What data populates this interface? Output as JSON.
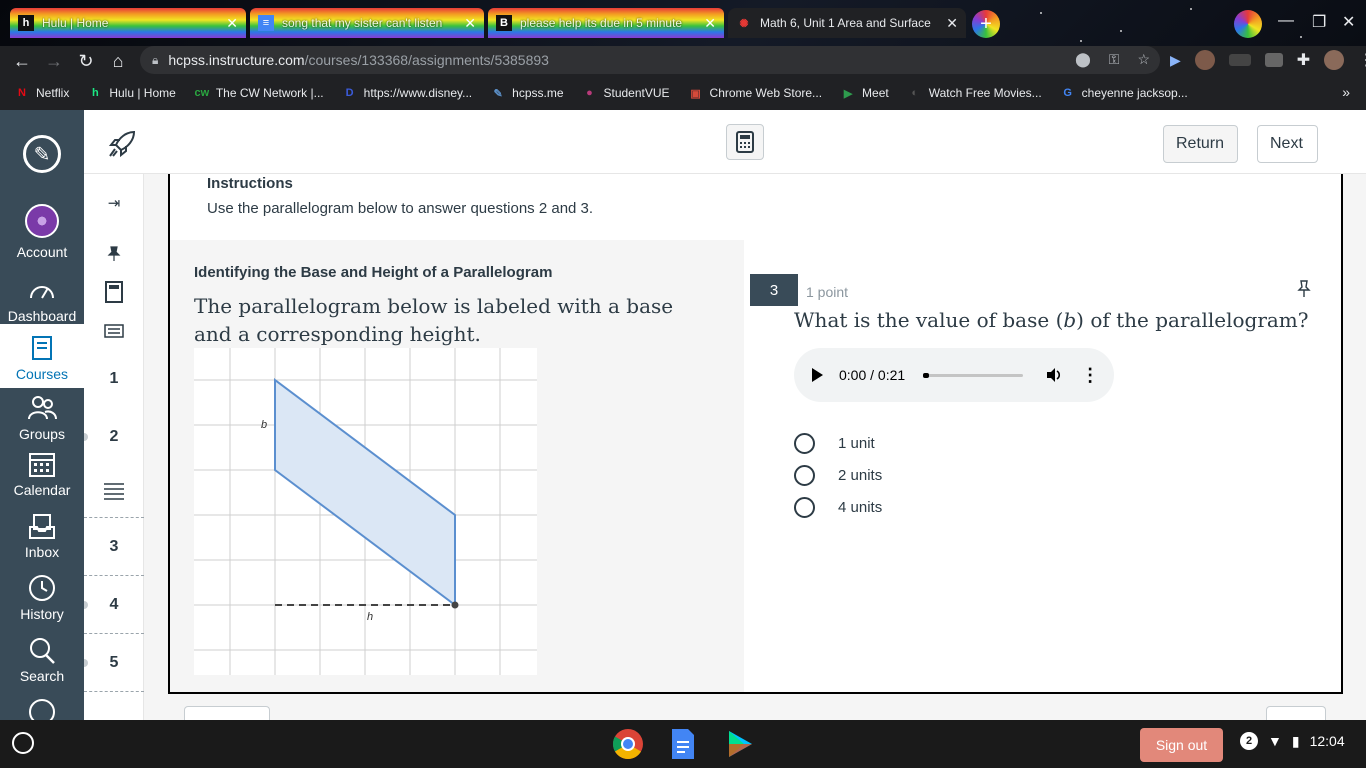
{
  "browser": {
    "tabs": [
      {
        "favicon": "h",
        "title": "Hulu | Home"
      },
      {
        "favicon": "≡",
        "title": "song that my sister can't listen"
      },
      {
        "favicon": "B",
        "title": "please help its due in 5 minute"
      },
      {
        "favicon": "✺",
        "title": "Math 6, Unit 1 Area and Surface"
      }
    ],
    "url_host": "hcpss.instructure.com",
    "url_path": "/courses/133368/assignments/5385893",
    "bookmarks": [
      {
        "icon": "N",
        "label": "Netflix",
        "color": "#e50914"
      },
      {
        "icon": "h",
        "label": "Hulu | Home",
        "color": "#1ce783"
      },
      {
        "icon": "cw",
        "label": "The CW Network |...",
        "color": "#2aa640"
      },
      {
        "icon": "D",
        "label": "https://www.disney...",
        "color": "#3b5bdb"
      },
      {
        "icon": "✎",
        "label": "hcpss.me",
        "color": "#5b8fc7"
      },
      {
        "icon": "●",
        "label": "StudentVUE",
        "color": "#b83a7a"
      },
      {
        "icon": "▣",
        "label": "Chrome Web Store...",
        "color": "#d44a3a"
      },
      {
        "icon": "▶",
        "label": "Meet",
        "color": "#2e9b4d"
      },
      {
        "icon": "◐",
        "label": "Watch Free Movies...",
        "color": "#555555"
      },
      {
        "icon": "G",
        "label": "cheyenne jacksop...",
        "color": "#4285f4"
      }
    ]
  },
  "globalnav": {
    "items": [
      {
        "label": "Account"
      },
      {
        "label": "Dashboard"
      },
      {
        "label": "Courses"
      },
      {
        "label": "Groups"
      },
      {
        "label": "Calendar"
      },
      {
        "label": "Inbox"
      },
      {
        "label": "History"
      },
      {
        "label": "Search"
      }
    ]
  },
  "header": {
    "return_label": "Return",
    "next_label": "Next"
  },
  "qnav": {
    "numbers": [
      "1",
      "2",
      "3",
      "4",
      "5"
    ]
  },
  "instructions": {
    "title": "Instructions",
    "text": "Use the parallelogram below to answer questions 2 and 3."
  },
  "stimulus": {
    "title": "Identifying the Base and Height of a Parallelogram",
    "body": " The parallelogram below is labeled with a base and a corresponding height.",
    "label_b": "b",
    "label_h": "h"
  },
  "question": {
    "number": "3",
    "points": "1 point",
    "text": "What is the value of base (𝑏) of the parallelogram?",
    "audio_time": "0:00 / 0:21",
    "audio_progress": 0.03,
    "options": [
      "1 unit",
      "2 units",
      "4 units"
    ]
  },
  "shelf": {
    "signout_label": "Sign out",
    "notifications": "2",
    "time": "12:04"
  },
  "colors": {
    "nav_bg": "#394b58",
    "canvas_blue": "#0374b5",
    "signout": "#e2887a"
  }
}
